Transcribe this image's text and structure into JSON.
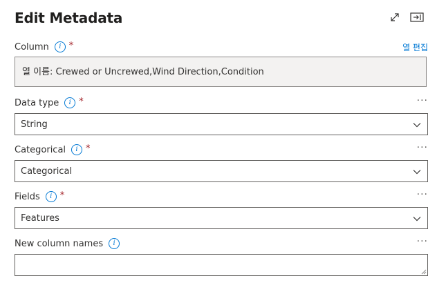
{
  "panel": {
    "title": "Edit Metadata",
    "expand_icon": "expand-icon",
    "dock_icon": "dock-panel-icon"
  },
  "column": {
    "label": "Column",
    "required_mark": "*",
    "info_icon": "i",
    "edit_link": "열 편집",
    "value": "열 이름: Crewed or Uncrewed,Wind Direction,Condition"
  },
  "data_type": {
    "label": "Data type",
    "required_mark": "*",
    "info_icon": "i",
    "more": "···",
    "value": "String"
  },
  "categorical": {
    "label": "Categorical",
    "required_mark": "*",
    "info_icon": "i",
    "more": "···",
    "value": "Categorical"
  },
  "fields": {
    "label": "Fields",
    "required_mark": "*",
    "info_icon": "i",
    "more": "···",
    "value": "Features"
  },
  "new_column_names": {
    "label": "New column names",
    "info_icon": "i",
    "more": "···",
    "value": ""
  },
  "colors": {
    "accent": "#0078d4",
    "required": "#a4262c",
    "border": "#605e5c",
    "disabled_bg": "#f3f2f1"
  }
}
